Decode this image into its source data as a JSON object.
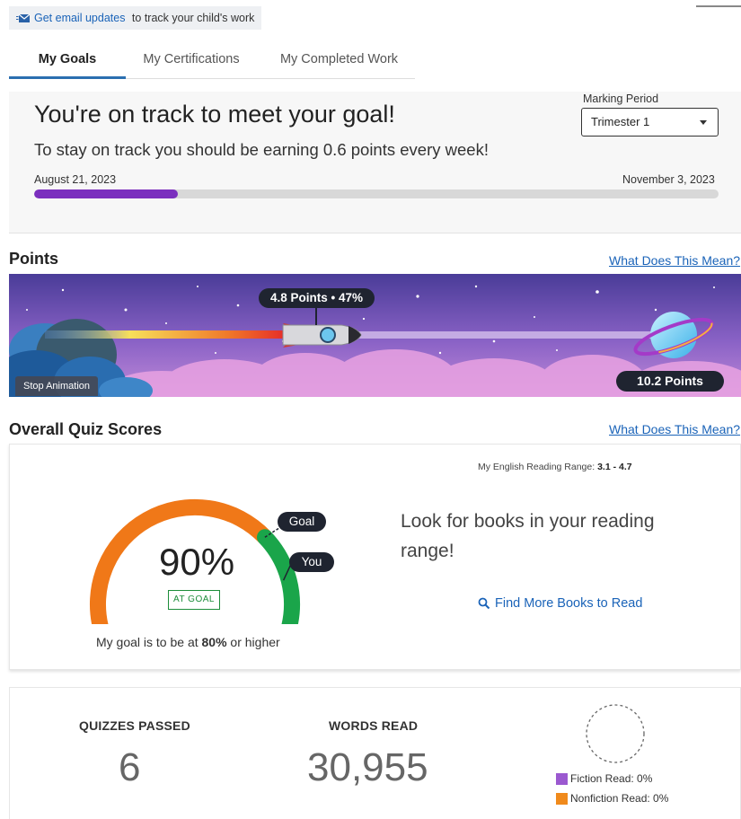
{
  "banner": {
    "link_text": "Get email updates",
    "rest_text": " to track your child's work",
    "icon": "envelope-icon"
  },
  "tabs": [
    {
      "label": "My Goals",
      "active": true
    },
    {
      "label": "My Certifications",
      "active": false
    },
    {
      "label": "My Completed Work",
      "active": false
    }
  ],
  "goal": {
    "title": "You're on track to meet your goal!",
    "subtitle": "To stay on track you should be earning 0.6 points every week!",
    "marking_period_label": "Marking Period",
    "marking_period_value": "Trimester 1",
    "start_date": "August 21, 2023",
    "end_date": "November 3, 2023",
    "progress_fraction": 0.21
  },
  "points": {
    "section_title": "Points",
    "help_link": "What Does This Mean?",
    "current_label": "4.8 Points • 47%",
    "goal_label": "10.2 Points",
    "stop_animation": "Stop Animation"
  },
  "quiz": {
    "section_title": "Overall Quiz Scores",
    "help_link": "What Does This Mean?",
    "range_label": "My English Reading Range:",
    "range_value": "3.1 - 4.7",
    "percent": "90%",
    "status_badge": "AT GOAL",
    "goal_pill": "Goal",
    "you_pill": "You",
    "goal_note_prefix": "My goal is to be at ",
    "goal_note_value": "80%",
    "goal_note_suffix": " or higher",
    "look_text": "Look for books in your reading range!",
    "find_link": "Find More Books to Read",
    "score_fraction": 0.9,
    "goal_fraction": 0.8
  },
  "stats": {
    "quizzes_label": "QUIZZES PASSED",
    "quizzes_value": "6",
    "words_label": "WORDS READ",
    "words_value": "30,955",
    "fiction_label": "Fiction Read: 0%",
    "nonfiction_label": "Nonfiction Read: 0%"
  },
  "colors": {
    "accent_blue": "#1a63b8",
    "progress_purple": "#7b2fbe",
    "gauge_orange": "#f07818",
    "gauge_green": "#1aa54a",
    "fiction_purple": "#9b59d0",
    "nonfiction_orange": "#f08a1c"
  }
}
